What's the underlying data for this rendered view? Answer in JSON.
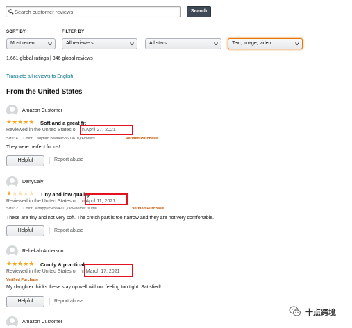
{
  "search": {
    "placeholder": "Search customer reviews",
    "button_label": "Search"
  },
  "filters": {
    "sort_label": "SORT BY",
    "filter_label": "FILTER BY",
    "sort_value": "Most recent",
    "reviewers_value": "All reviewers",
    "stars_value": "All stars",
    "format_value": "Text, image, video"
  },
  "summary": "1,661 global ratings | 346 global reviews",
  "translate_link": "Translate all reviews to English",
  "section_title": "From the United States",
  "reviews": [
    {
      "author": "Amazon Customer",
      "rating": 5,
      "stars": "★★★★★",
      "title": "Soft and a great fit",
      "reviewed_prefix": "Reviewed in the United States o",
      "date": "n April 27, 2021",
      "details": "Size: 4T  |  Color: Ladybird Beetle(5h603610)/Flowers",
      "verified": "Verified Purchase",
      "body": "They were perfect for us!",
      "helpful_label": "Helpful",
      "report_label": "Report abuse"
    },
    {
      "author": "DanyCaly",
      "rating": 1,
      "stars": "★",
      "stars_empty": "★★★★",
      "title": "Tiny and low quality",
      "reviewed_prefix": "Reviewed in the United States o",
      "date": "n April 11, 2021",
      "details": "Size: 2T  |  Color: Mhappy(54564211)/Toweome/Tsuper",
      "verified": "Verified Purchase",
      "body": "These are tiny and not very soft. The crotch part is too narrow and they are not very comfortable.",
      "helpful_label": "Helpful",
      "report_label": "Report abuse"
    },
    {
      "author": "Rebekah Anderson",
      "rating": 5,
      "stars": "★★★★★",
      "title": "Comfy & practical",
      "reviewed_prefix": "Reviewed in the United States o",
      "date": "n March 17, 2021",
      "verified": "Verified Purchase",
      "body": "My daughter thinks these stay up well without feeling too tight. Satisfied!",
      "helpful_label": "Helpful",
      "report_label": "Report abuse"
    },
    {
      "author": "Amazon Customer"
    }
  ],
  "watermark": {
    "text": "十点跨境"
  },
  "colors": {
    "star": "#f6a41b",
    "link": "#007185",
    "verified": "#c45500",
    "highlight_box": "#e3121e",
    "search_button": "#3f4a56"
  }
}
